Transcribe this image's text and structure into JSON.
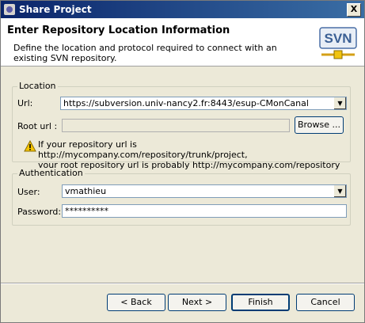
{
  "window": {
    "title": "Share Project",
    "close_label": "X"
  },
  "header": {
    "heading": "Enter Repository Location Information",
    "description": "Define the location and protocol required to connect with an existing SVN repository.",
    "logo_text": "SVN"
  },
  "location": {
    "group_title": "Location",
    "url_label": "Url:",
    "url_value": "https://subversion.univ-nancy2.fr:8443/esup-CMonCanal",
    "root_url_label": "Root url :",
    "root_url_value": "",
    "browse_label": "Browse ...",
    "note": "If your repository url is http://mycompany.com/repository/trunk/project, your root repository url is probably http://mycompany.com/repository",
    "note_line1": "If your repository url is http://mycompany.com/repository/trunk/project,",
    "note_line2": "your root repository url is probably http://mycompany.com/repository"
  },
  "authentication": {
    "group_title": "Authentication",
    "user_label": "User:",
    "user_value": "vmathieu",
    "password_label": "Password:",
    "password_value": "**********"
  },
  "buttons": {
    "back": "< Back",
    "next": "Next >",
    "finish": "Finish",
    "cancel": "Cancel"
  },
  "colors": {
    "title_bar": "#0a246a",
    "dialog_bg": "#ece9d8",
    "accent": "#003c74"
  }
}
